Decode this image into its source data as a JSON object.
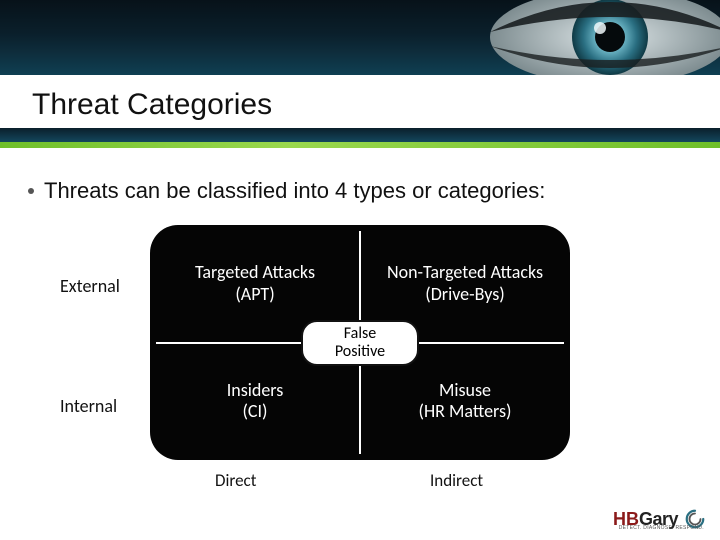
{
  "title": "Threat Categories",
  "bullet": "Threats can be classified into 4 types or categories:",
  "matrix": {
    "rows": [
      "External",
      "Internal"
    ],
    "cols": [
      "Direct",
      "Indirect"
    ],
    "center": "False\nPositive",
    "cells": {
      "tl": "Targeted Attacks\n(APT)",
      "tr": "Non-Targeted Attacks\n(Drive-Bys)",
      "bl": "Insiders\n(CI)",
      "br": "Misuse\n(HR Matters)"
    }
  },
  "logo": {
    "brand_hb": "HB",
    "brand_gary": "Gary",
    "tagline": "DETECT. DIAGNOSE. RESPOND."
  }
}
